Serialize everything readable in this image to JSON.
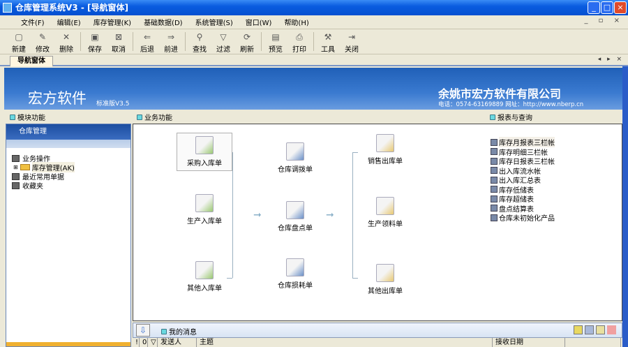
{
  "window": {
    "title": "仓库管理系统V3 - [导航窗体]",
    "min": "_",
    "max": "□",
    "close": "×"
  },
  "menu": [
    "文件(F)",
    "编辑(E)",
    "库存管理(K)",
    "基础数据(D)",
    "系统管理(S)",
    "窗口(W)",
    "帮助(H)"
  ],
  "mdi_controls": "_ ▫ ×",
  "toolbar": [
    {
      "label": "新建",
      "icon": "new-icon",
      "glyph": "▢"
    },
    {
      "label": "修改",
      "icon": "edit-icon",
      "glyph": "✎"
    },
    {
      "label": "删除",
      "icon": "delete-icon",
      "glyph": "✕"
    },
    {
      "label": "保存",
      "icon": "save-icon",
      "glyph": "▣"
    },
    {
      "label": "取消",
      "icon": "cancel-icon",
      "glyph": "⊠"
    },
    {
      "label": "后退",
      "icon": "back-icon",
      "glyph": "⇐"
    },
    {
      "label": "前进",
      "icon": "forward-icon",
      "glyph": "⇒"
    },
    {
      "label": "查找",
      "icon": "find-icon",
      "glyph": "⚲"
    },
    {
      "label": "过滤",
      "icon": "filter-icon",
      "glyph": "▽"
    },
    {
      "label": "刷新",
      "icon": "refresh-icon",
      "glyph": "⟳"
    },
    {
      "label": "预览",
      "icon": "preview-icon",
      "glyph": "▤"
    },
    {
      "label": "打印",
      "icon": "print-icon",
      "glyph": "⎙"
    },
    {
      "label": "工具",
      "icon": "tools-icon",
      "glyph": "⚒"
    },
    {
      "label": "关闭",
      "icon": "exit-icon",
      "glyph": "⇥"
    }
  ],
  "tab": {
    "label": "导航窗体",
    "nav": "◂ ▸ ×"
  },
  "banner": {
    "brand": "宏方软件",
    "version": "标准版V3.5",
    "company": "余姚市宏方软件有限公司",
    "contact": "电话：0574-63169889    网址：http://www.nberp.cn"
  },
  "sections": {
    "modules": "模块功能",
    "business": "业务功能",
    "reports": "报表与查询"
  },
  "left": {
    "header": "仓库管理",
    "tree": [
      "业务操作",
      "库存管理(AK)",
      "最近常用单据",
      "收藏夹"
    ]
  },
  "business": {
    "inbound": [
      "采购入库单",
      "生产入库单",
      "其他入库单"
    ],
    "middle": [
      "仓库调拨单",
      "仓库盘点单",
      "仓库损耗单"
    ],
    "outbound": [
      "销售出库单",
      "生产领料单",
      "其他出库单"
    ]
  },
  "reports": [
    "库存月报表三栏帐",
    "库存明细三栏帐",
    "库存日报表三栏帐",
    "出入库流水帐",
    "出入库汇总表",
    "库存低储表",
    "库存超储表",
    "盘点结算表",
    "仓库未初始化产品"
  ],
  "messages": {
    "title": "我的消息",
    "columns": [
      "!",
      "0",
      "▽",
      "发送人",
      "主题",
      "接收日期"
    ]
  }
}
